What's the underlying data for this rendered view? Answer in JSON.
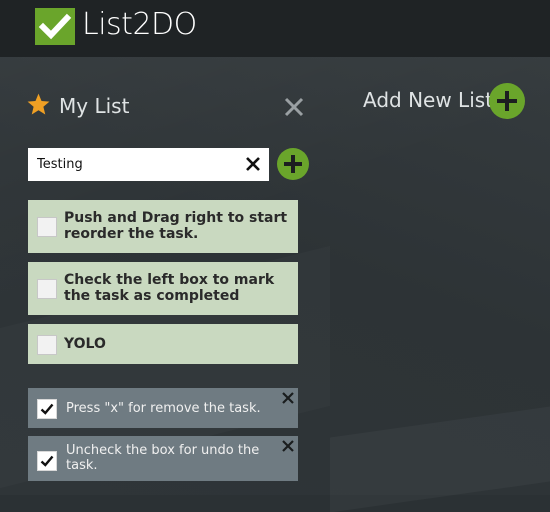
{
  "app": {
    "title": "List2DO"
  },
  "list": {
    "title": "My List",
    "add_new_label": "Add New List"
  },
  "task_input": {
    "value": "Testing"
  },
  "tasks": [
    {
      "text": "Push and Drag right to start reorder the task.",
      "completed": false
    },
    {
      "text": "Check the left box to mark the task as completed",
      "completed": false
    },
    {
      "text": "YOLO",
      "completed": false
    }
  ],
  "completed_tasks": [
    {
      "text": "Press \"x\" for remove the task.",
      "completed": true
    },
    {
      "text": "Uncheck the box for undo the task.",
      "completed": true
    }
  ],
  "colors": {
    "accent": "#6aa52b",
    "star": "#f0a024",
    "task_bg": "#c9d9c0",
    "completed_bg": "#6f7b82",
    "topbar": "#1f2325"
  },
  "icons": [
    "logo-check-icon",
    "star-icon",
    "close-icon",
    "plus-icon",
    "clear-icon",
    "checkmark-icon",
    "delete-icon"
  ]
}
